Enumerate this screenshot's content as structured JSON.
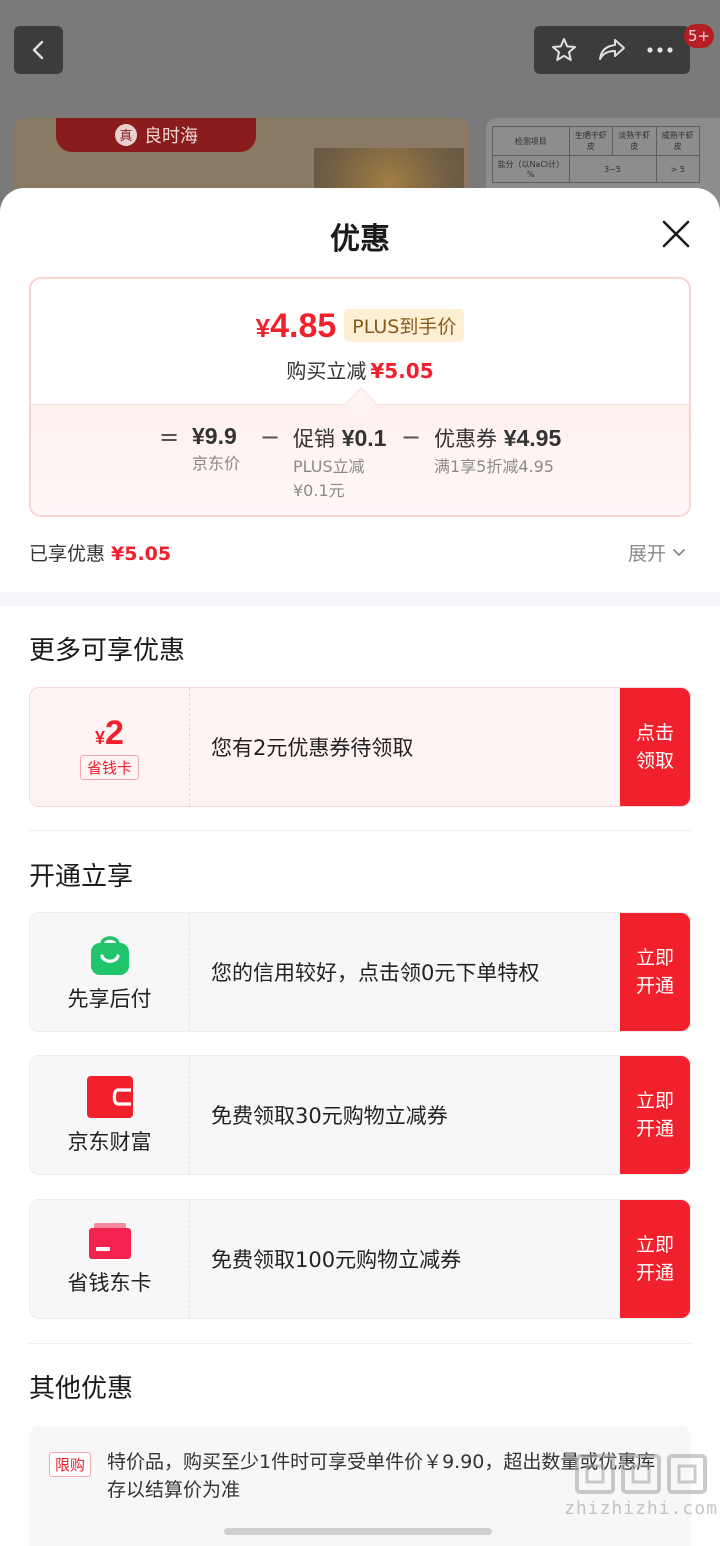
{
  "background": {
    "badge": "5+",
    "brand": "良时海",
    "table": {
      "headers": [
        "检测项目",
        "生晒干虾皮",
        "淡熟干虾皮",
        "咸熟干虾皮"
      ],
      "row": [
        "盐分（以NaCl计）%",
        "3~5",
        "",
        "> 5"
      ]
    }
  },
  "sheet": {
    "title": "优惠",
    "price_card": {
      "currency": "¥",
      "final_price": "4.85",
      "plus_tag": "PLUS到手价",
      "discount_label": "购买立减",
      "discount_value": "¥5.05",
      "equals": "=",
      "minus": "−",
      "items": [
        {
          "main_label": "",
          "main_value": "¥9.9",
          "sub": "京东价"
        },
        {
          "main_label": "促销",
          "main_value": "¥0.1",
          "sub": "PLUS立减\n¥0.1元"
        },
        {
          "main_label": "优惠券",
          "main_value": "¥4.95",
          "sub": "满1享5折减4.95"
        }
      ]
    },
    "enjoyed": {
      "label": "已享优惠",
      "value": "¥5.05",
      "expand": "展开"
    },
    "more_section": {
      "title": "更多可享优惠",
      "coupon": {
        "currency": "¥",
        "amount": "2",
        "tag": "省钱卡",
        "text": "您有2元优惠券待领取",
        "button": "点击\n领取"
      }
    },
    "open_section": {
      "title": "开通立享",
      "items": [
        {
          "icon": "shopping-bag-icon",
          "label": "先享后付",
          "text": "您的信用较好，点击领0元下单特权",
          "button": "立即\n开通",
          "color": "#1fc46b"
        },
        {
          "icon": "wallet-icon",
          "label": "京东财富",
          "text": "免费领取30元购物立减券",
          "button": "立即\n开通",
          "color": "#f0202d"
        },
        {
          "icon": "card-icon",
          "label": "省钱东卡",
          "text": "免费领取100元购物立减券",
          "button": "立即\n开通",
          "color": "#f2244f"
        }
      ]
    },
    "other_section": {
      "title": "其他优惠",
      "tag": "限购",
      "text": "特价品，购买至少1件时可享受单件价￥9.90，超出数量或优惠库存以结算价为准"
    }
  },
  "watermark": {
    "site": "zhizhizhi.com"
  },
  "colors": {
    "accent": "#f0202d",
    "gold_tag_bg": "#fdefd3",
    "pink_border": "#fbd3d3"
  }
}
